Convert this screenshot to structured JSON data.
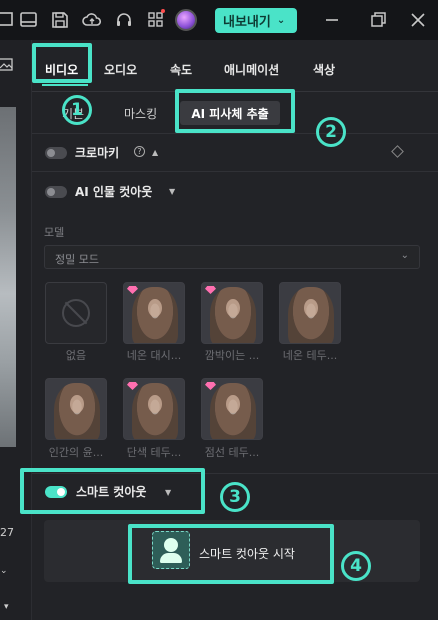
{
  "toolbar": {
    "icons": [
      "screen-icon",
      "layout-icon",
      "save-icon",
      "cloud-upload-icon",
      "headset-icon",
      "apps-icon",
      "avatar"
    ],
    "export_label": "내보내기",
    "window_icons": [
      "minimize-icon",
      "restore-icon",
      "close-icon"
    ]
  },
  "left_strip": {
    "number": "27",
    "marker": "⌄",
    "dropdown": "▾"
  },
  "tabs": [
    {
      "label": "비디오",
      "active": true
    },
    {
      "label": "오디오"
    },
    {
      "label": "속도"
    },
    {
      "label": "애니메이션"
    },
    {
      "label": "색상"
    }
  ],
  "subtabs": [
    {
      "label": "기본"
    },
    {
      "label": "마스킹"
    },
    {
      "label": "AI 피사체 추출",
      "active": true
    }
  ],
  "chroma_key": {
    "label": "크로마키",
    "help": "?",
    "caret": "▲",
    "enabled": false
  },
  "ai_cutout": {
    "label": "AI 인물 컷아웃",
    "caret": "▼",
    "enabled": false
  },
  "model": {
    "label": "모델",
    "value": "정밀 모드"
  },
  "presets": [
    {
      "label": "없음",
      "premium": false,
      "none": true
    },
    {
      "label": "네온 대시...",
      "premium": true
    },
    {
      "label": "깜박이는 ...",
      "premium": true
    },
    {
      "label": "네온 테두...",
      "premium": false
    },
    {
      "label": "인간의 윤...",
      "premium": false
    },
    {
      "label": "단색 테두...",
      "premium": true
    },
    {
      "label": "점선 테두...",
      "premium": true
    }
  ],
  "smart_cutout": {
    "label": "스마트 컷아웃",
    "caret": "▼",
    "enabled": true
  },
  "start_button": {
    "label": "스마트 컷아웃 시작"
  },
  "steps": [
    "1",
    "2",
    "3",
    "4"
  ],
  "colors": {
    "accent": "#4ae3c8",
    "panel": "#222327",
    "topbar": "#141518"
  }
}
